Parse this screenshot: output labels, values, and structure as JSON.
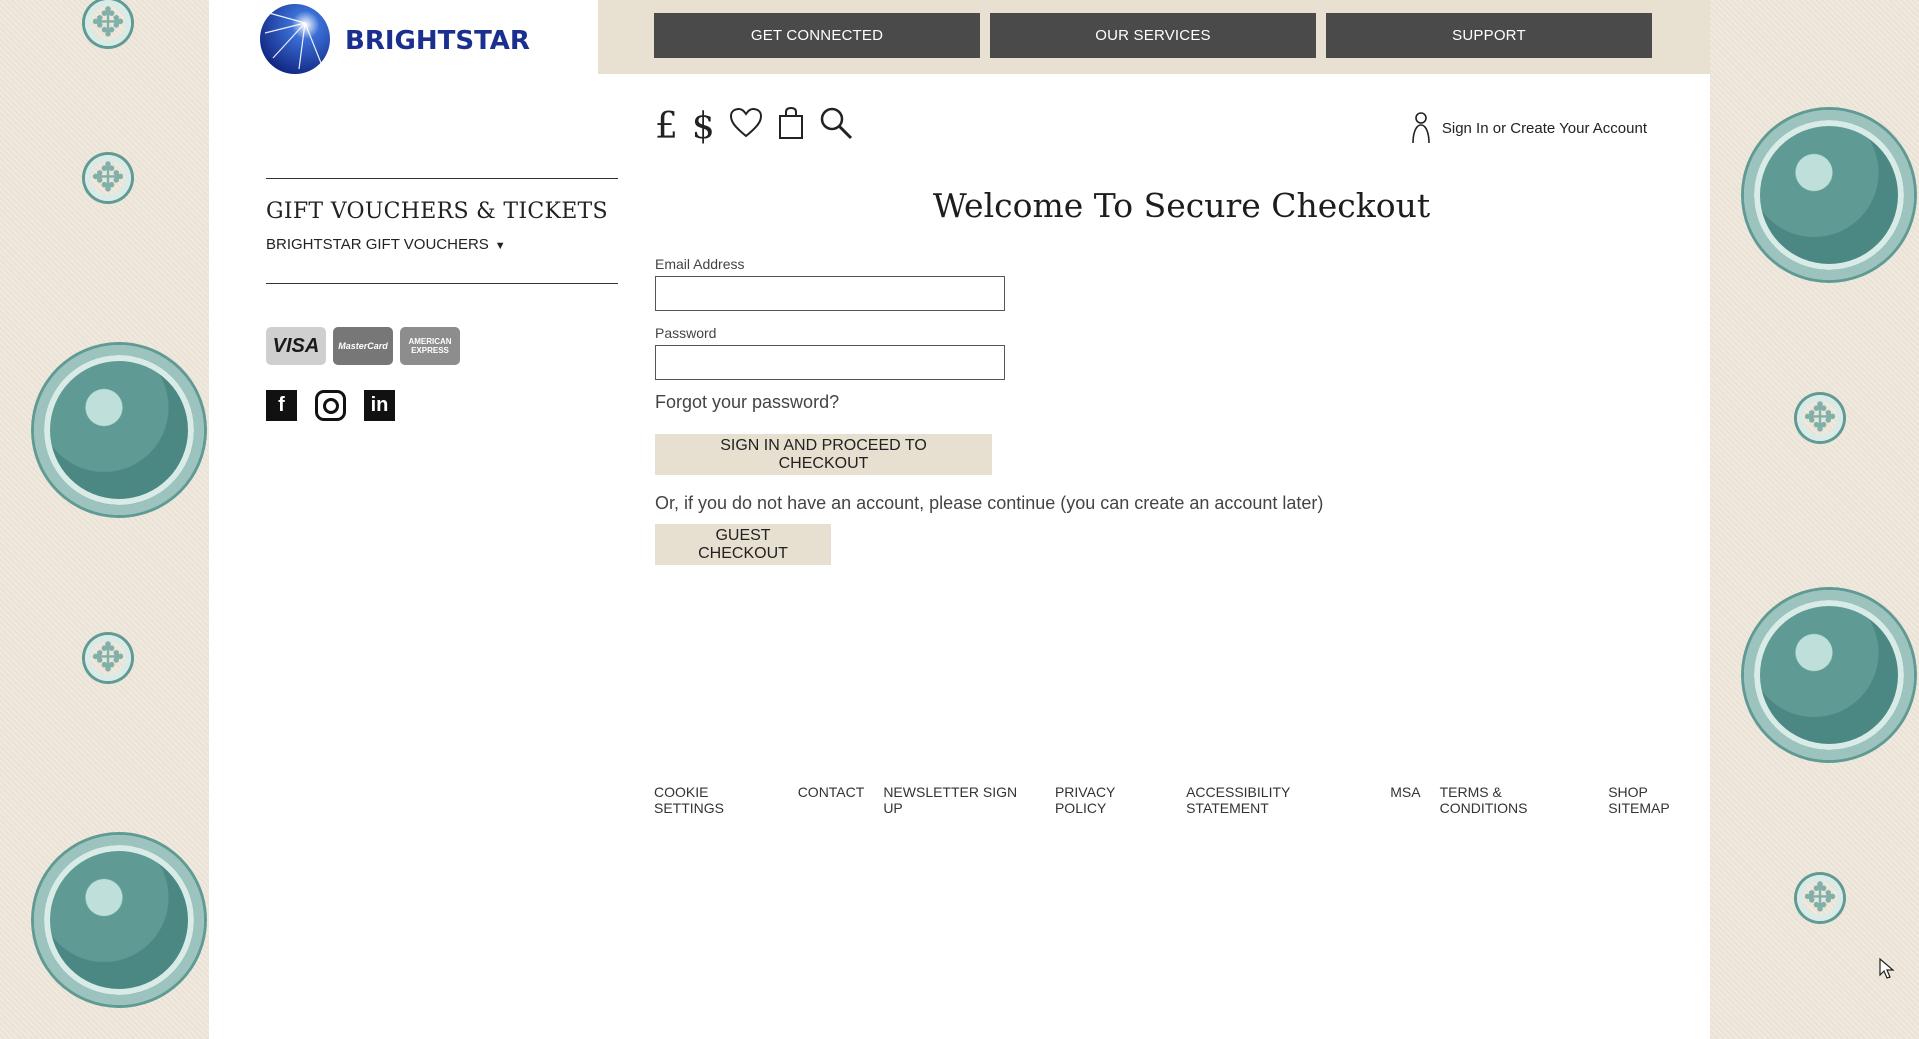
{
  "brand": {
    "name": "BRIGHTSTAR",
    "primary_color": "#1b2f8f"
  },
  "nav": [
    {
      "label": "GET CONNECTED"
    },
    {
      "label": "OUR SERVICES"
    },
    {
      "label": "SUPPORT"
    }
  ],
  "utility_icons": [
    {
      "name": "pound-currency-icon",
      "glyph": "£"
    },
    {
      "name": "dollar-currency-icon",
      "glyph": "$"
    },
    {
      "name": "wishlist-heart-icon",
      "glyph": "♡"
    },
    {
      "name": "shopping-bag-icon",
      "glyph": "🛍"
    },
    {
      "name": "search-icon",
      "glyph": "🔍"
    }
  ],
  "account": {
    "label": "Sign In or Create Your Account"
  },
  "sidebar": {
    "title": "GIFT VOUCHERS & TICKETS",
    "subtitle": "BRIGHTSTAR GIFT VOUCHERS",
    "caret": "▼"
  },
  "payment_cards": {
    "visa": "VISA",
    "mastercard": "MasterCard",
    "amex": "AMERICAN EXPRESS"
  },
  "social": {
    "facebook": "f",
    "linkedin": "in"
  },
  "main": {
    "title": "Welcome To Secure Checkout",
    "email_label": "Email Address",
    "email_value": "",
    "password_label": "Password",
    "password_value": "",
    "forgot": "Forgot your password?",
    "signin_button": "SIGN IN AND PROCEED TO CHECKOUT",
    "or_text": "Or, if you do not have an account, please continue (you can create an account later)",
    "guest_button": "GUEST CHECKOUT"
  },
  "footer": [
    "COOKIE SETTINGS",
    "CONTACT",
    "NEWSLETTER SIGN UP",
    "PRIVACY POLICY",
    "ACCESSIBILITY STATEMENT",
    "MSA",
    "TERMS & CONDITIONS",
    "SHOP SITEMAP"
  ]
}
